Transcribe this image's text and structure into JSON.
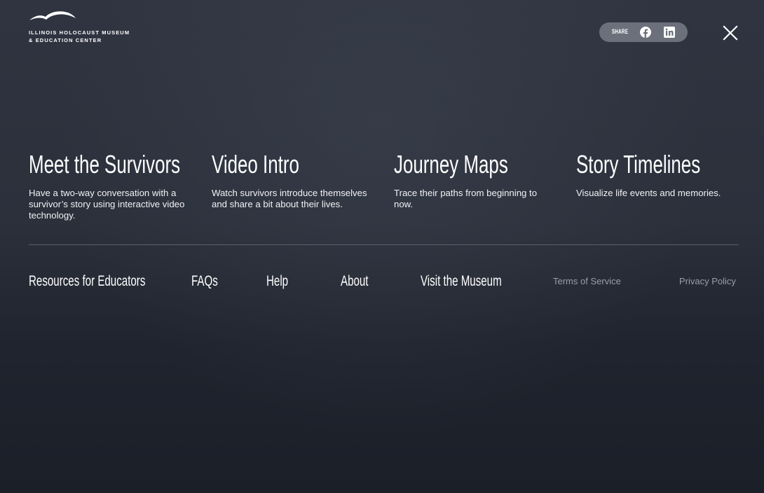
{
  "logo": {
    "line1": "ILLINOIS HOLOCAUST MUSEUM",
    "line2": "& EDUCATION CENTER",
    "icon": "bird-logo"
  },
  "share": {
    "label": "SHARE",
    "icons": [
      "facebook-icon",
      "linkedin-icon"
    ]
  },
  "close_icon": "close-icon",
  "cards": [
    {
      "title": "Meet the Survivors",
      "description": "Have a two-way conversation with a survivor’s story using interactive video technology."
    },
    {
      "title": "Video Intro",
      "description": "Watch survivors introduce themselves and share a bit about their lives."
    },
    {
      "title": "Journey Maps",
      "description": "Trace their paths from beginning to now."
    },
    {
      "title": "Story Timelines",
      "description": "Visualize life events and memories."
    }
  ],
  "footer": {
    "links": [
      "Resources for Educators",
      "FAQs",
      "Help",
      "About",
      "Visit the Museum"
    ],
    "legal": [
      "Terms of Service",
      "Privacy Policy"
    ]
  },
  "colors": {
    "background_top": "#2f3440",
    "background_bottom": "#1b1f28",
    "share_pill": "#6b707b",
    "divider": "#5b606b",
    "legal_text": "#9a9ea8"
  }
}
